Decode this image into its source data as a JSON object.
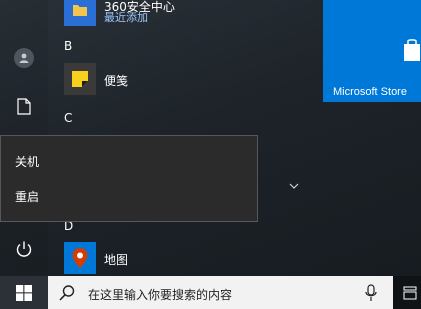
{
  "app_list": {
    "recent_app": {
      "name": "360安全中心",
      "subtitle": "最近添加"
    },
    "sections": [
      {
        "letter": "B",
        "apps": [
          {
            "name": "便笺",
            "icon": "sticky-notes-icon"
          }
        ]
      },
      {
        "letter": "C",
        "apps": []
      },
      {
        "letter": "D",
        "apps": [
          {
            "name": "地图",
            "icon": "maps-icon"
          }
        ]
      }
    ]
  },
  "side_rail": {
    "items": [
      {
        "icon": "user-avatar-icon"
      },
      {
        "icon": "document-icon"
      },
      {
        "icon": "power-icon"
      }
    ]
  },
  "power_menu": {
    "items": [
      {
        "label": "关机"
      },
      {
        "label": "重启"
      }
    ]
  },
  "tiles": {
    "store": {
      "label": "Microsoft Store",
      "color": "#0078d7"
    }
  },
  "taskbar": {
    "search_placeholder": "在这里输入你要搜索的内容",
    "start_icon": "windows-logo-icon",
    "mic_icon": "microphone-icon",
    "taskview_icon": "task-view-icon"
  },
  "colors": {
    "accent": "#0078d7",
    "menu_bg": "#2b2b2b",
    "sticky_yellow": "#f7d11b",
    "maps_red": "#d83b01"
  }
}
